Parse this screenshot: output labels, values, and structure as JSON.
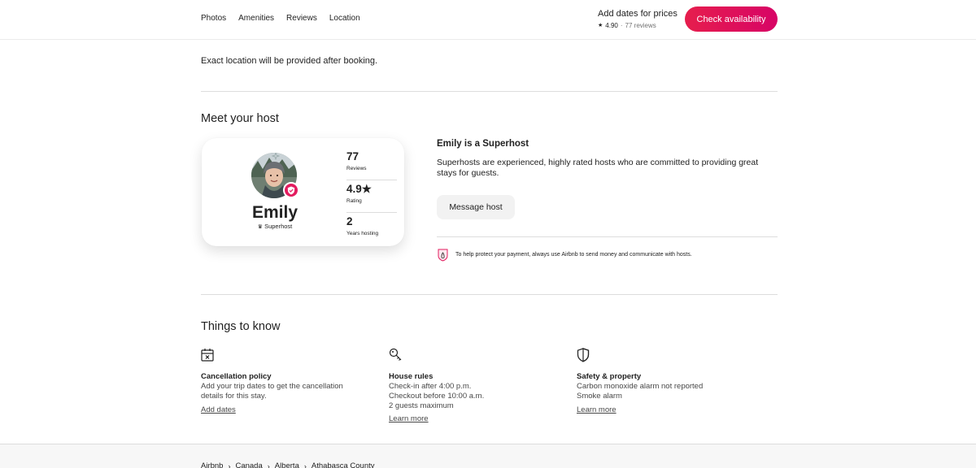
{
  "nav": {
    "links": [
      "Photos",
      "Amenities",
      "Reviews",
      "Location"
    ],
    "price_title": "Add dates for prices",
    "rating": "4.90",
    "dot": "·",
    "reviews": "77 reviews",
    "cta": "Check availability"
  },
  "location": {
    "exact_note": "Exact location will be provided after booking."
  },
  "host": {
    "section_title": "Meet your host",
    "name": "Emily",
    "badge": "Superhost",
    "stats": [
      {
        "value": "77",
        "label": "Reviews"
      },
      {
        "value": "4.9★",
        "label": "Rating"
      },
      {
        "value": "2",
        "label": "Years hosting"
      }
    ],
    "superhost_title": "Emily is a Superhost",
    "superhost_desc": "Superhosts are experienced, highly rated hosts who are committed to providing great stays for guests.",
    "message_button": "Message host",
    "payment_note": "To help protect your payment, always use Airbnb to send money and communicate with hosts."
  },
  "things_to_know": {
    "title": "Things to know",
    "columns": [
      {
        "icon": "calendar-x-icon",
        "title": "Cancellation policy",
        "lines": [
          "Add your trip dates to get the cancellation",
          "details for this stay."
        ],
        "link": "Add dates"
      },
      {
        "icon": "key-icon",
        "title": "House rules",
        "lines": [
          "Check-in after 4:00 p.m.",
          "Checkout before 10:00 a.m.",
          "2 guests maximum"
        ],
        "link": "Learn more"
      },
      {
        "icon": "shield-icon",
        "title": "Safety & property",
        "lines": [
          "Carbon monoxide alarm not reported",
          "Smoke alarm"
        ],
        "link": "Learn more"
      }
    ]
  },
  "footer": {
    "breadcrumbs": [
      "Airbnb",
      "Canada",
      "Alberta",
      "Athabasca County"
    ],
    "separator": "›"
  },
  "colors": {
    "accent": "#e31c5f",
    "text": "#222222",
    "muted": "#717171",
    "divider": "#dddddd"
  }
}
